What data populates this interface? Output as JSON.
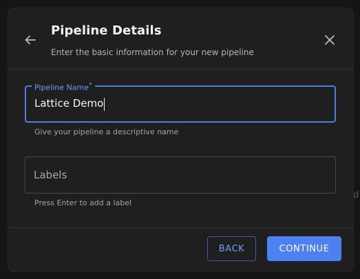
{
  "dialog": {
    "title": "Pipeline Details",
    "subtitle": "Enter the basic information for your new pipeline"
  },
  "form": {
    "name_field": {
      "label": "Pipeline Name",
      "required_marker": "*",
      "value": "Lattice Demo",
      "helper": "Give your pipeline a descriptive name"
    },
    "labels_field": {
      "placeholder": "Labels",
      "helper": "Press Enter to add a label"
    }
  },
  "footer": {
    "back_label": "BACK",
    "continue_label": "CONTINUE"
  },
  "background": {
    "fragment": "d"
  },
  "colors": {
    "accent": "#4d80f0",
    "surface": "#1f1f1f",
    "backdrop": "#151515"
  },
  "icons": {
    "back": "arrow-left-icon",
    "close": "close-icon"
  }
}
